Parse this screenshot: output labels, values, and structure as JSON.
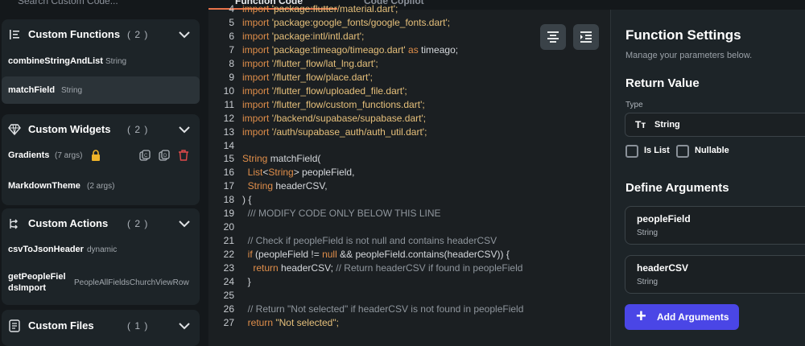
{
  "topbar": {
    "search_placeholder": "Search Custom Code...",
    "tabs": [
      {
        "label": "Function Code"
      },
      {
        "label": "Code Copilot"
      }
    ]
  },
  "sidebar": {
    "functions": {
      "title": "Custom Functions",
      "count": "( 2 )",
      "items": [
        {
          "name": "combineStringAndList",
          "type": "String"
        },
        {
          "name": "matchField",
          "type": "String"
        }
      ]
    },
    "widgets": {
      "title": "Custom Widgets",
      "count": "( 2 )",
      "items": [
        {
          "name": "Gradients",
          "type": "(7 args)"
        },
        {
          "name": "MarkdownTheme",
          "type": "(2 args)"
        }
      ]
    },
    "actions": {
      "title": "Custom Actions",
      "count": "( 2 )",
      "items": [
        {
          "name": "csvToJsonHeader",
          "type": "dynamic"
        },
        {
          "name_line1": "getPeopleFiel",
          "name_line2": "dsImport",
          "type": "PeopleAllFieldsChurchViewRow"
        }
      ]
    },
    "files": {
      "title": "Custom Files",
      "count": "( 1 )"
    }
  },
  "editor": {
    "lines": [
      {
        "n": "4",
        "parts": [
          {
            "t": "import ",
            "c": "kw"
          },
          {
            "t": "'package:flutter/material.dart';",
            "c": "str"
          }
        ]
      },
      {
        "n": "5",
        "parts": [
          {
            "t": "import ",
            "c": "kw"
          },
          {
            "t": "'package:google_fonts/google_fonts.dart';",
            "c": "str"
          }
        ]
      },
      {
        "n": "6",
        "parts": [
          {
            "t": "import ",
            "c": "kw"
          },
          {
            "t": "'package:intl/intl.dart';",
            "c": "str"
          }
        ]
      },
      {
        "n": "7",
        "parts": [
          {
            "t": "import ",
            "c": "kw"
          },
          {
            "t": "'package:timeago/timeago.dart'",
            "c": "str"
          },
          {
            "t": " as ",
            "c": "kw"
          },
          {
            "t": "timeago;",
            "c": ""
          }
        ]
      },
      {
        "n": "8",
        "parts": [
          {
            "t": "import ",
            "c": "kw"
          },
          {
            "t": "'/flutter_flow/lat_lng.dart';",
            "c": "str"
          }
        ]
      },
      {
        "n": "9",
        "parts": [
          {
            "t": "import ",
            "c": "kw"
          },
          {
            "t": "'/flutter_flow/place.dart';",
            "c": "str"
          }
        ]
      },
      {
        "n": "10",
        "parts": [
          {
            "t": "import ",
            "c": "kw"
          },
          {
            "t": "'/flutter_flow/uploaded_file.dart';",
            "c": "str"
          }
        ]
      },
      {
        "n": "11",
        "parts": [
          {
            "t": "import ",
            "c": "kw"
          },
          {
            "t": "'/flutter_flow/custom_functions.dart';",
            "c": "str"
          }
        ]
      },
      {
        "n": "12",
        "parts": [
          {
            "t": "import ",
            "c": "kw"
          },
          {
            "t": "'/backend/supabase/supabase.dart';",
            "c": "str"
          }
        ]
      },
      {
        "n": "13",
        "parts": [
          {
            "t": "import ",
            "c": "kw"
          },
          {
            "t": "'/auth/supabase_auth/auth_util.dart';",
            "c": "str"
          }
        ]
      },
      {
        "n": "14",
        "parts": []
      },
      {
        "n": "15",
        "parts": [
          {
            "t": "String ",
            "c": "kw"
          },
          {
            "t": "matchField(",
            "c": ""
          }
        ]
      },
      {
        "n": "16",
        "parts": [
          {
            "t": "  List",
            "c": "kw"
          },
          {
            "t": "<",
            "c": ""
          },
          {
            "t": "String",
            "c": "kw"
          },
          {
            "t": "> peopleField,",
            "c": ""
          }
        ]
      },
      {
        "n": "17",
        "parts": [
          {
            "t": "  String ",
            "c": "kw"
          },
          {
            "t": "headerCSV,",
            "c": ""
          }
        ]
      },
      {
        "n": "18",
        "parts": [
          {
            "t": ") {",
            "c": ""
          }
        ]
      },
      {
        "n": "19",
        "parts": [
          {
            "t": "  /// MODIFY CODE ONLY BELOW THIS LINE",
            "c": "cm"
          }
        ]
      },
      {
        "n": "20",
        "parts": []
      },
      {
        "n": "21",
        "parts": [
          {
            "t": "  // Check if peopleField is not null and contains headerCSV",
            "c": "cm"
          }
        ]
      },
      {
        "n": "22",
        "parts": [
          {
            "t": "  if ",
            "c": "kw"
          },
          {
            "t": "(peopleField != ",
            "c": ""
          },
          {
            "t": "null",
            "c": "nl"
          },
          {
            "t": " && peopleField.contains(headerCSV)) {",
            "c": ""
          }
        ]
      },
      {
        "n": "23",
        "parts": [
          {
            "t": "    return ",
            "c": "kw"
          },
          {
            "t": "headerCSV; ",
            "c": ""
          },
          {
            "t": "// Return headerCSV if found in peopleField",
            "c": "cm"
          }
        ]
      },
      {
        "n": "24",
        "parts": [
          {
            "t": "  }",
            "c": ""
          }
        ]
      },
      {
        "n": "25",
        "parts": []
      },
      {
        "n": "26",
        "parts": [
          {
            "t": "  // Return \"Not selected\" if headerCSV is not found in peopleField",
            "c": "cm"
          }
        ]
      },
      {
        "n": "27",
        "parts": [
          {
            "t": "  return ",
            "c": "kw"
          },
          {
            "t": "\"Not selected\";",
            "c": "str"
          }
        ]
      }
    ]
  },
  "panel": {
    "title": "Function Settings",
    "subtitle": "Manage your parameters below.",
    "return_heading": "Return Value",
    "type_label": "Type",
    "type_icon": "Tт",
    "type_value": "String",
    "is_list_label": "Is List",
    "nullable_label": "Nullable",
    "args_heading": "Define Arguments",
    "args": [
      {
        "name": "peopleField",
        "type": "String"
      },
      {
        "name": "headerCSV",
        "type": "String"
      }
    ],
    "add_button_label": "Add Arguments",
    "add_button_icon": "+"
  },
  "colors": {
    "accent": "#e8734a",
    "primary_button": "#4a46e6",
    "lock": "#f0b429",
    "delete": "#e04a4a"
  }
}
